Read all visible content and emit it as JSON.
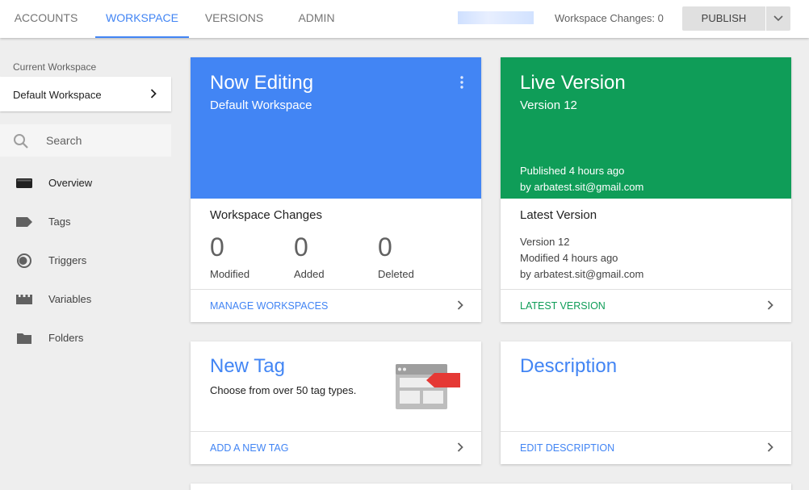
{
  "nav": {
    "tabs": [
      {
        "label": "ACCOUNTS"
      },
      {
        "label": "WORKSPACE"
      },
      {
        "label": "VERSIONS"
      },
      {
        "label": "ADMIN"
      }
    ],
    "workspace_changes": "Workspace Changes: 0",
    "publish_label": "PUBLISH"
  },
  "sidebar": {
    "current_workspace_label": "Current Workspace",
    "current_workspace_name": "Default Workspace",
    "search_label": "Search",
    "items": [
      {
        "label": "Overview",
        "icon": "briefcase-icon"
      },
      {
        "label": "Tags",
        "icon": "tag-icon"
      },
      {
        "label": "Triggers",
        "icon": "trigger-icon"
      },
      {
        "label": "Variables",
        "icon": "variables-icon"
      },
      {
        "label": "Folders",
        "icon": "folder-icon"
      }
    ]
  },
  "now_editing": {
    "title": "Now Editing",
    "subtitle": "Default Workspace",
    "section_title": "Workspace Changes",
    "stats": [
      {
        "value": "0",
        "label": "Modified"
      },
      {
        "value": "0",
        "label": "Added"
      },
      {
        "value": "0",
        "label": "Deleted"
      }
    ],
    "footer_label": "MANAGE WORKSPACES"
  },
  "live_version": {
    "title": "Live Version",
    "subtitle": "Version 12",
    "published": "Published 4 hours ago",
    "by": "by arbatest.sit@gmail.com",
    "section_title": "Latest Version",
    "latest_version": "Version 12",
    "modified": "Modified 4 hours ago",
    "latest_by": "by arbatest.sit@gmail.com",
    "footer_label": "LATEST VERSION"
  },
  "new_tag": {
    "title": "New Tag",
    "subtitle": "Choose from over 50 tag types.",
    "footer_label": "ADD A NEW TAG"
  },
  "description": {
    "title": "Description",
    "footer_label": "EDIT DESCRIPTION"
  },
  "colors": {
    "blue": "#4285f4",
    "green": "#0f9d58",
    "red": "#e53935"
  }
}
